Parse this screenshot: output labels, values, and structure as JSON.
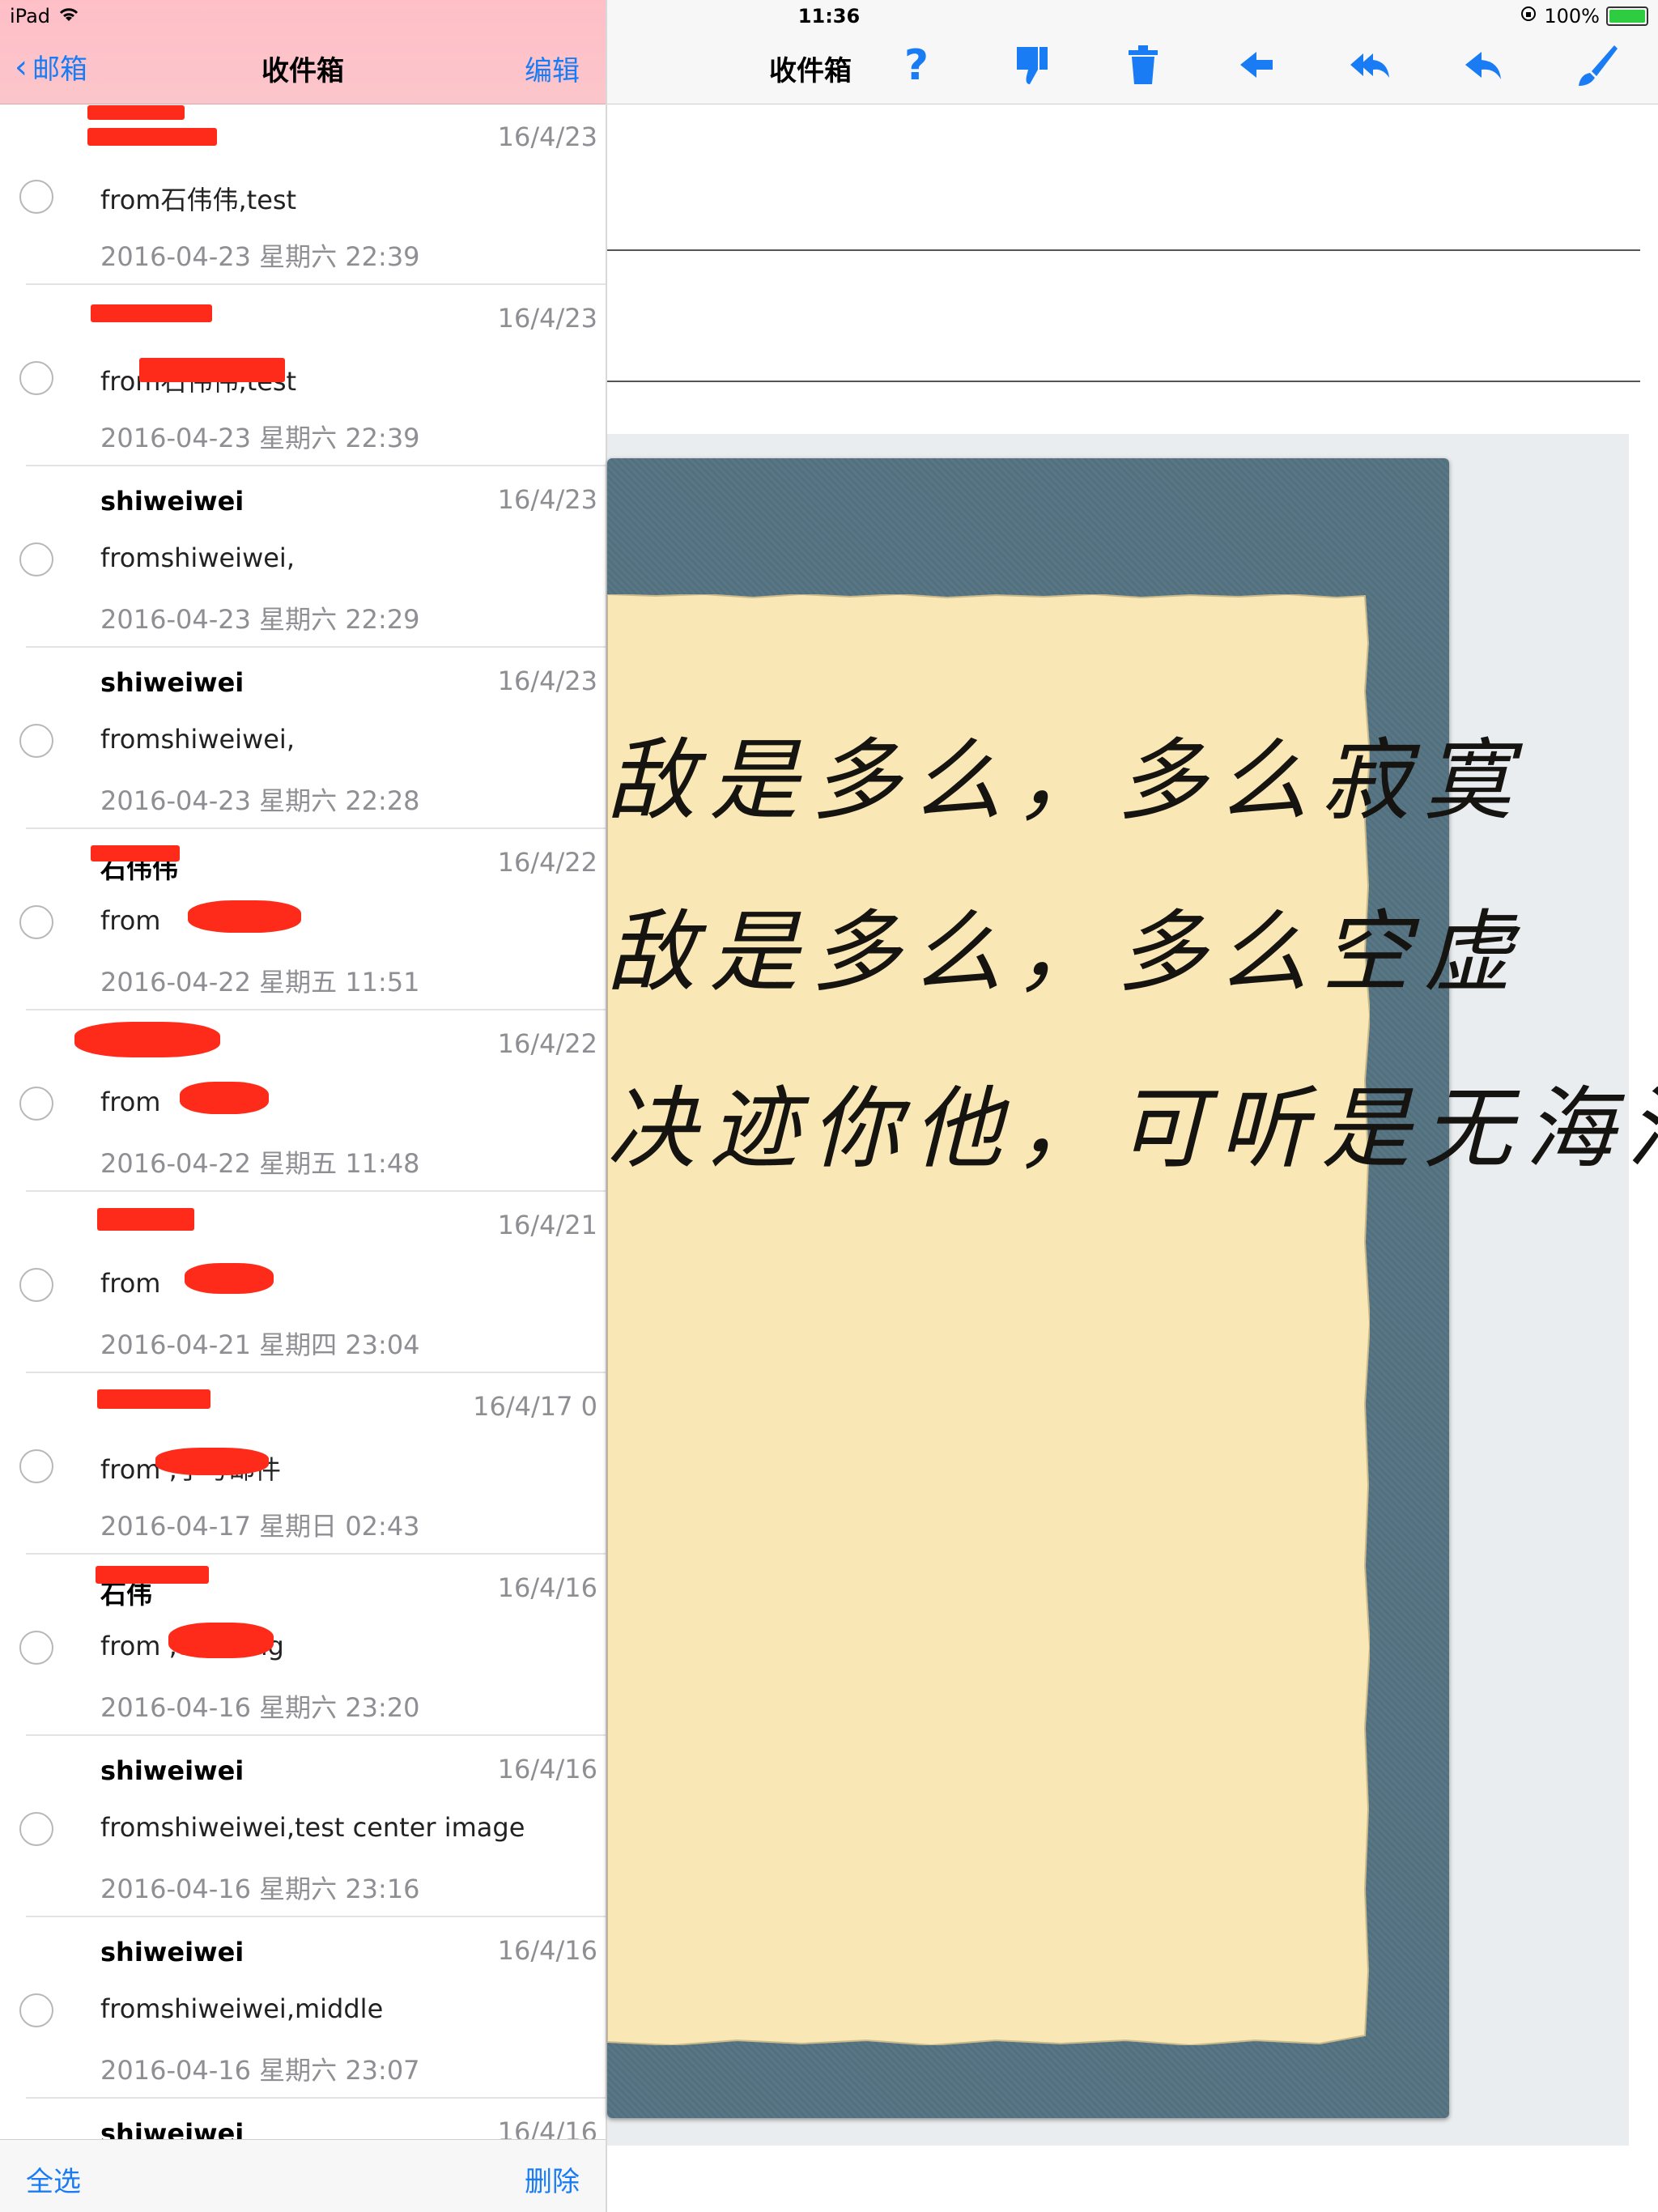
{
  "status": {
    "device": "iPad",
    "time": "11:36",
    "battery": "100%"
  },
  "master": {
    "back_label": "邮箱",
    "title": "收件箱",
    "edit_label": "编辑",
    "select_all_label": "全选",
    "delete_label": "删除",
    "rows": [
      {
        "sender": "",
        "date": "16/4/23",
        "subject": "from石伟伟,test",
        "detail": "2016-04-23 星期六 22:39"
      },
      {
        "sender": "",
        "date": "16/4/23",
        "subject": "from石伟伟,test",
        "detail": "2016-04-23 星期六 22:39"
      },
      {
        "sender": "shiweiwei",
        "date": "16/4/23",
        "subject": "fromshiweiwei,",
        "detail": "2016-04-23 星期六 22:29"
      },
      {
        "sender": "shiweiwei",
        "date": "16/4/23",
        "subject": "fromshiweiwei,",
        "detail": "2016-04-23 星期六 22:28"
      },
      {
        "sender": "石伟伟",
        "date": "16/4/22",
        "subject": "from",
        "detail": "2016-04-22 星期五 11:51"
      },
      {
        "sender": "",
        "date": "16/4/22",
        "subject": "from",
        "detail": "2016-04-22 星期五 11:48"
      },
      {
        "sender": "",
        "date": "16/4/21",
        "subject": "from",
        "detail": "2016-04-21 星期四 23:04"
      },
      {
        "sender": "",
        "date": "16/4/17 0",
        "subject": "from          ,手写邮件",
        "detail": "2016-04-17 星期日 02:43"
      },
      {
        "sender": "石伟",
        "date": "16/4/16",
        "subject": "from          ,test  img",
        "detail": "2016-04-16 星期六 23:20"
      },
      {
        "sender": "shiweiwei",
        "date": "16/4/16",
        "subject": "fromshiweiwei,test center image",
        "detail": "2016-04-16 星期六 23:16"
      },
      {
        "sender": "shiweiwei",
        "date": "16/4/16",
        "subject": "fromshiweiwei,middle",
        "detail": "2016-04-16 星期六 23:07"
      },
      {
        "sender": "shiweiwei",
        "date": "16/4/16",
        "subject": "",
        "detail": ""
      }
    ]
  },
  "detail": {
    "title": "收件箱",
    "icons": [
      "help-icon",
      "thumbs-down-icon",
      "trash-icon",
      "forward-icon",
      "reply-all-icon",
      "reply-icon",
      "brush-icon"
    ],
    "handwriting": [
      "敌是多么，多么寂寞",
      "敌是多么，多么空虚",
      "决迹你他，可听是无海洋"
    ]
  },
  "colors": {
    "accent": "#1a7cf5",
    "nav_pink": "#fbc6cb",
    "redaction": "#ff2b1a"
  }
}
